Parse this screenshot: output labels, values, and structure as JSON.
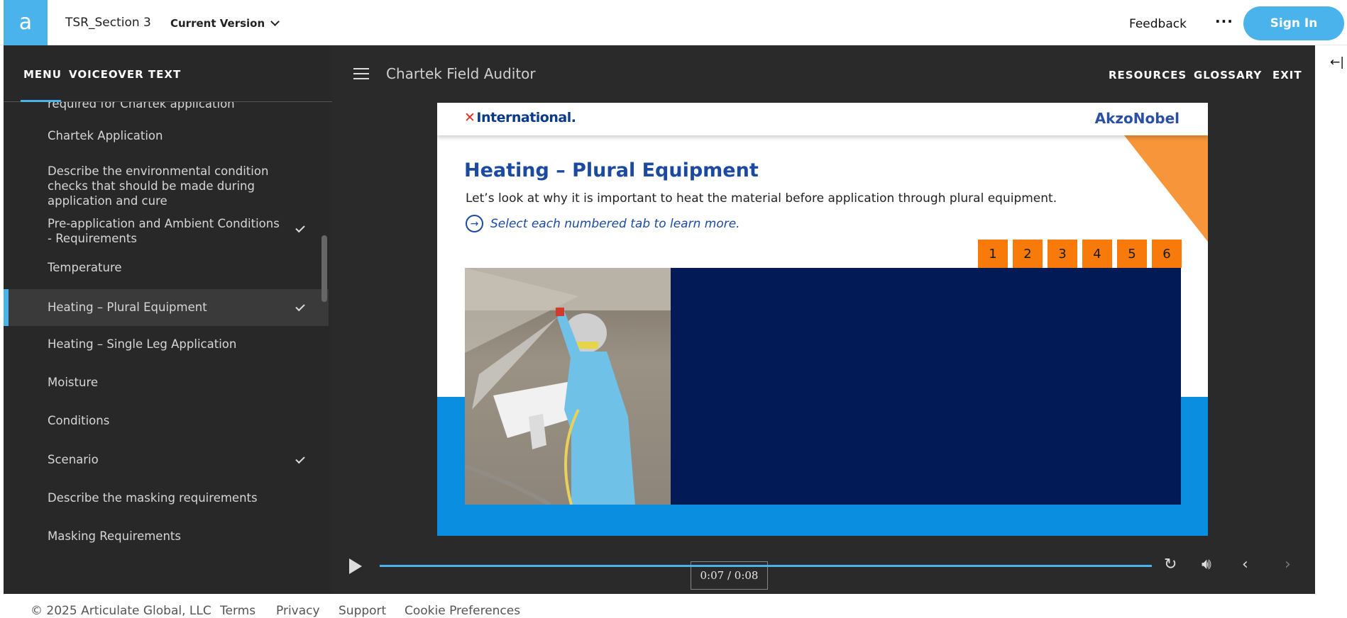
{
  "topbar": {
    "logo_glyph": "a",
    "project_title": "TSR_Section 3",
    "version_label": "Current Version",
    "feedback_label": "Feedback",
    "more_label": "···",
    "signin_label": "Sign In"
  },
  "sidebar": {
    "tabs": [
      "MENU",
      "VOICEOVER TEXT"
    ],
    "items": [
      {
        "label": "required for Chartek application",
        "checked": false,
        "active": false
      },
      {
        "label": "Chartek Application",
        "checked": false,
        "active": false
      },
      {
        "label": "Describe the environmental condition checks that should be made during application and cure",
        "checked": false,
        "active": false
      },
      {
        "label": "Pre-application and Ambient Conditions - Requirements",
        "checked": true,
        "active": false
      },
      {
        "label": "Temperature",
        "checked": false,
        "active": false
      },
      {
        "label": "Heating – Plural Equipment",
        "checked": true,
        "active": true
      },
      {
        "label": "Heating – Single Leg Application",
        "checked": false,
        "active": false
      },
      {
        "label": "Moisture",
        "checked": false,
        "active": false
      },
      {
        "label": "Conditions",
        "checked": false,
        "active": false
      },
      {
        "label": "Scenario",
        "checked": true,
        "active": false
      },
      {
        "label": "Describe the masking requirements",
        "checked": false,
        "active": false
      },
      {
        "label": "Masking Requirements",
        "checked": false,
        "active": false
      }
    ]
  },
  "player": {
    "course_title": "Chartek Field Auditor",
    "nav": [
      "RESOURCES",
      "GLOSSARY",
      "EXIT"
    ],
    "time_tooltip": "0:07 / 0:08",
    "playback_progress": 1.0
  },
  "slide": {
    "brand_left_mark": "✕",
    "brand_left": "International.",
    "brand_right": "AkzoNobel",
    "title": "Heating – Plural Equipment",
    "subtitle": "Let’s look at why it is important to heat the material before application through plural equipment.",
    "instruction": "Select each numbered tab to learn more.",
    "tabs": [
      "1",
      "2",
      "3",
      "4",
      "5",
      "6"
    ]
  },
  "footer": {
    "copyright": "© 2025 Articulate Global, LLC",
    "links": [
      "Terms",
      "Privacy",
      "Support",
      "Cookie Preferences"
    ]
  },
  "colors": {
    "accent": "#4ab3ec",
    "slide_orange": "#f87a0a",
    "slide_navy": "#021a56",
    "slide_blue": "#0a8ee0"
  }
}
